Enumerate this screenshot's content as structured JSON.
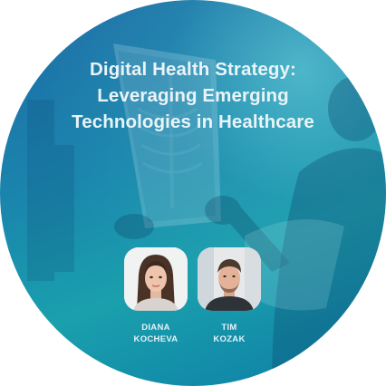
{
  "title": {
    "line1": "Digital Health Strategy:",
    "line2": "Leveraging Emerging",
    "line3": "Technologies in Healthcare"
  },
  "speakers": [
    {
      "first_name": "DIANA",
      "last_name": "KOCHEVA"
    },
    {
      "first_name": "TIM",
      "last_name": "KOZAK"
    }
  ],
  "colors": {
    "background_dark": "#1e6aa6",
    "background_teal": "#1aa0ad",
    "text": "#e9f4f8"
  },
  "icons": {
    "background": "doctor-holding-xray-photo"
  }
}
